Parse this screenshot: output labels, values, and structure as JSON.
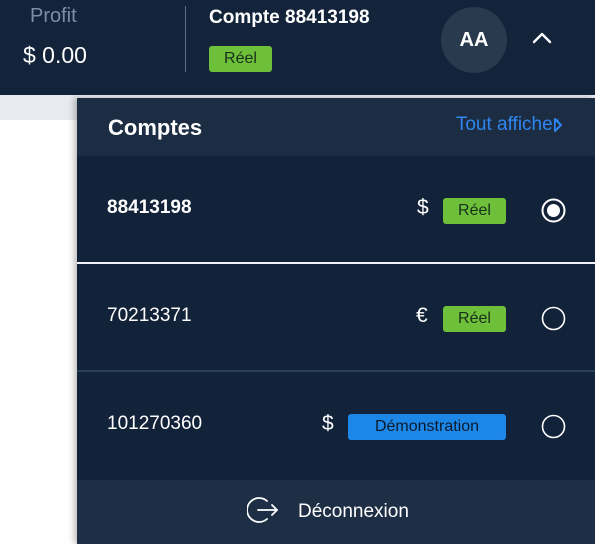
{
  "header": {
    "profit_label": "Profit",
    "profit_value": "$ 0.00",
    "account_title": "Compte 88413198",
    "account_badge": "Réel",
    "avatar_initials": "AA",
    "toggle_icon": "chevron-up-icon"
  },
  "accounts_panel": {
    "title": "Comptes",
    "show_all_label": "Tout afficher",
    "show_all_icon": "chevron-right-icon",
    "accounts": [
      {
        "number": "88413198",
        "currency": "$",
        "type": "Réel",
        "selected": true
      },
      {
        "number": "70213371",
        "currency": "€",
        "type": "Réel",
        "selected": false
      },
      {
        "number": "101270360",
        "currency": "$",
        "type": "Démonstration",
        "selected": false
      }
    ],
    "logout_label": "Déconnexion",
    "logout_icon": "logout-icon"
  },
  "colors": {
    "header_bg": "#13233a",
    "panel_bg": "#122238",
    "real_badge": "#6ebf3a",
    "demo_badge": "#1d87e8",
    "link": "#2f86f0"
  }
}
